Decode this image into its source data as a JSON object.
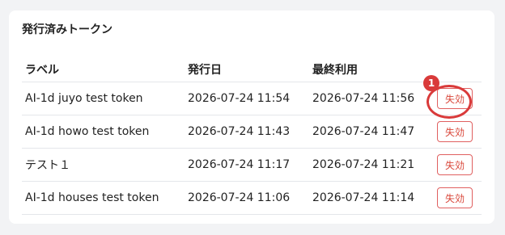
{
  "card": {
    "title": "発行済みトークン"
  },
  "table": {
    "headers": {
      "label": "ラベル",
      "issued": "発行日",
      "last_used": "最終利用"
    },
    "rows": [
      {
        "label": "AI-1d juyo test token",
        "issued": "2026-07-24 11:54",
        "last_used": "2026-07-24 11:56",
        "action": "失効"
      },
      {
        "label": "AI-1d howo test token",
        "issued": "2026-07-24 11:43",
        "last_used": "2026-07-24 11:47",
        "action": "失効"
      },
      {
        "label": "テスト１",
        "issued": "2026-07-24 11:17",
        "last_used": "2026-07-24 11:21",
        "action": "失効"
      },
      {
        "label": "AI-1d houses test token",
        "issued": "2026-07-24 11:06",
        "last_used": "2026-07-24 11:14",
        "action": "失効"
      }
    ]
  },
  "annotation": {
    "badge": "1",
    "color": "#d93a3a"
  }
}
